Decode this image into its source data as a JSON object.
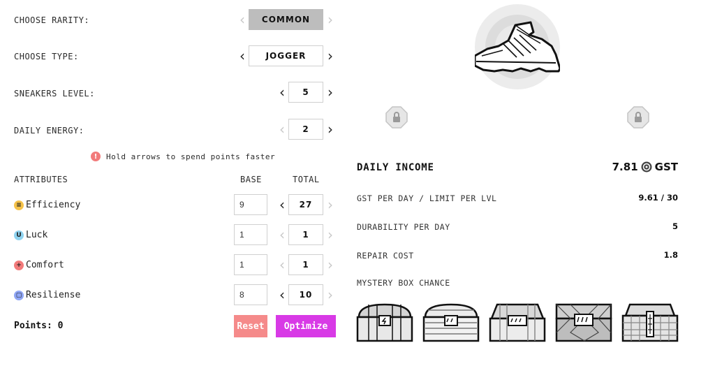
{
  "config": {
    "rarity": {
      "label": "CHOOSE RARITY:",
      "value": "COMMON"
    },
    "type": {
      "label": "CHOOSE TYPE:",
      "value": "JOGGER"
    },
    "level": {
      "label": "SNEAKERS LEVEL:",
      "value": "5"
    },
    "energy": {
      "label": "DAILY ENERGY:",
      "value": "2"
    },
    "hint": "Hold arrows to spend points faster"
  },
  "attributes": {
    "header": "ATTRIBUTES",
    "base_header": "BASE",
    "total_header": "TOTAL",
    "rows": [
      {
        "name": "Efficiency",
        "base": "9",
        "total": "27",
        "icon": "efficiency-icon",
        "color": "#f5c24a"
      },
      {
        "name": "Luck",
        "base": "1",
        "total": "1",
        "icon": "luck-icon",
        "color": "#8fd3f0"
      },
      {
        "name": "Comfort",
        "base": "1",
        "total": "1",
        "icon": "comfort-icon",
        "color": "#f27b7b"
      },
      {
        "name": "Resiliense",
        "base": "8",
        "total": "10",
        "icon": "resilience-icon",
        "color": "#8fa6f5"
      }
    ]
  },
  "points": {
    "label": "Points: 0"
  },
  "buttons": {
    "reset": "Reset",
    "optimize": "Optimize",
    "reset_color": "#f58a8a",
    "optimize_color": "#d83ae6"
  },
  "income": {
    "title": "DAILY INCOME",
    "value": "7.81",
    "currency": "GST",
    "stats": [
      {
        "label": "GST PER DAY / LIMIT PER LVL",
        "value": "9.61 / 30"
      },
      {
        "label": "DURABILITY PER DAY",
        "value": "5"
      },
      {
        "label": "REPAIR COST",
        "value": "1.8"
      }
    ],
    "mystery_label": "MYSTERY BOX CHANCE"
  }
}
